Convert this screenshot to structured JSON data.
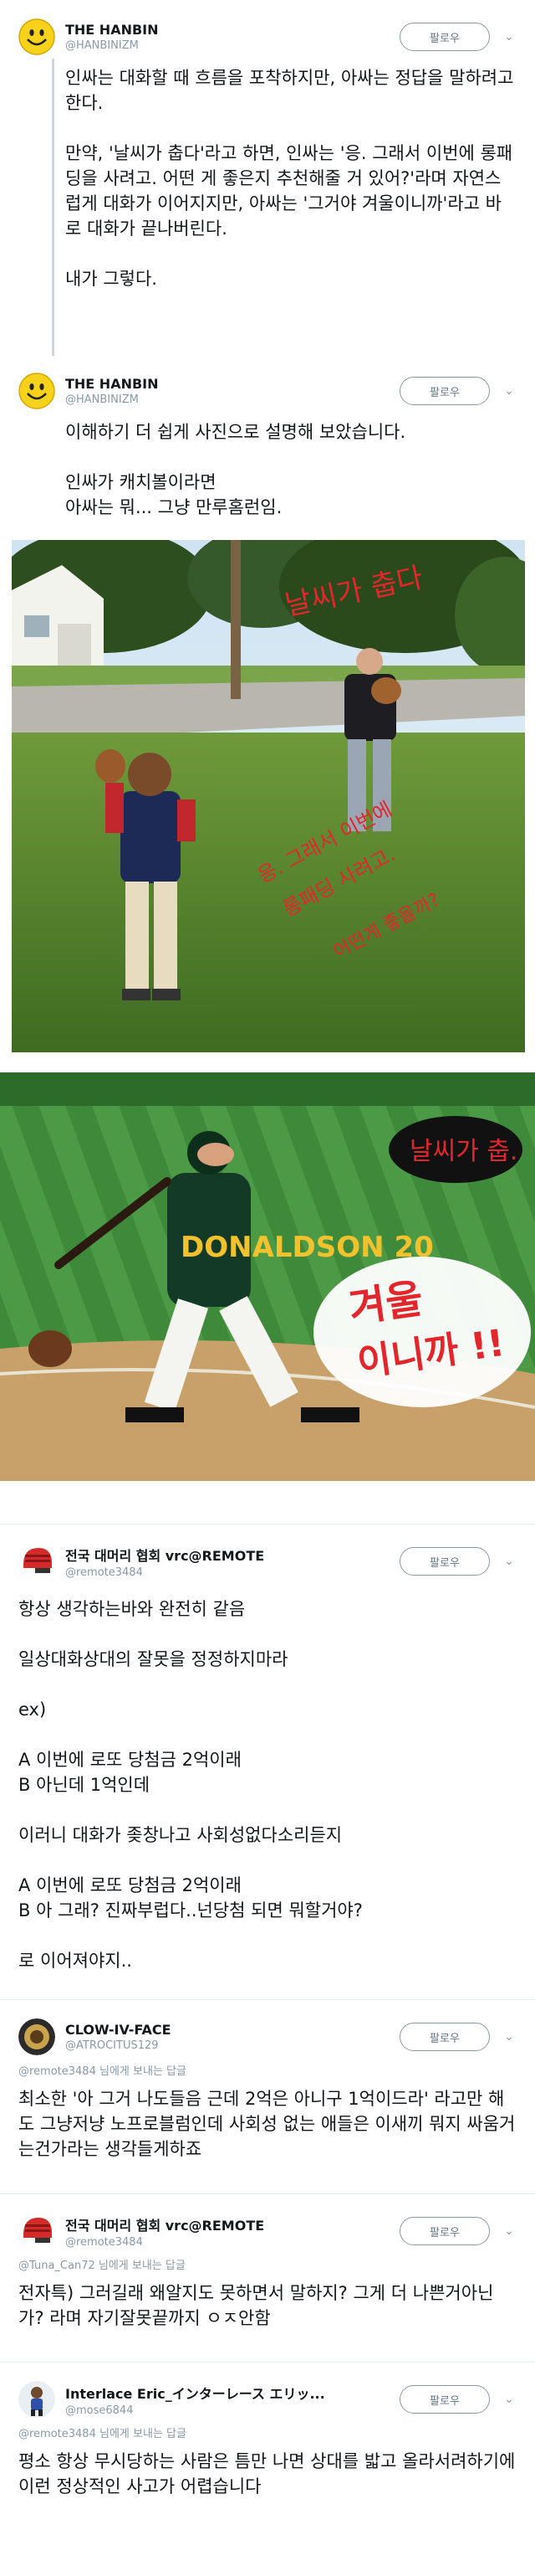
{
  "tweets": [
    {
      "name": "THE HANBIN",
      "handle": "@HANBINIZM",
      "follow_label": "팔로우",
      "paragraphs": [
        "인싸는 대화할 때 흐름을 포착하지만, 아싸는 정답을 말하려고 한다.",
        "만약, '날씨가 춥다'라고 하면, 인싸는 '응. 그래서 이번에 롱패딩을 사려고. 어떤 게 좋은지 추천해줄 거 있어?'라며 자연스럽게 대화가 이어지지만, 아싸는 '그거야 겨울이니까'라고 바로 대화가 끝나버린다.",
        "내가 그렇다."
      ]
    },
    {
      "name": "THE HANBIN",
      "handle": "@HANBINIZM",
      "follow_label": "팔로우",
      "paragraphs": [
        "이해하기 더 쉽게 사진으로 설명해 보았습니다.",
        "인싸가 캐치볼이라면\n아싸는 뭐... 그냥 만루홈런임."
      ],
      "photo1_texts": [
        "날씨가 춥다",
        "응. 그래서 이번에",
        "롱패딩 사려고.",
        "어떤게 좋을까?"
      ],
      "photo2_texts": [
        "날씨가 춥.",
        "겨울",
        "이니까 !!"
      ],
      "jersey_text": "DONALDSON 20"
    },
    {
      "name": "전국 대머리 협회 vrc@REMOTE",
      "handle": "@remote3484",
      "follow_label": "팔로우",
      "paragraphs": [
        "항상 생각하는바와 완전히 같음",
        "일상대화상대의 잘못을 정정하지마라",
        "ex)",
        "A 이번에 로또 당첨금 2억이래\nB 아닌데 1억인데",
        "이러니 대화가 좆창나고 사회성없다소리듣지",
        "A 이번에 로또 당첨금 2억이래\nB 아 그래? 진짜부럽다..넌당첨 되면 뭐할거야?",
        "로 이어져야지.."
      ]
    },
    {
      "name": "CLOW-IV-FACE",
      "handle": "@ATROCITUS129",
      "follow_label": "팔로우",
      "replyto": "@remote3484 님에게 보내는 답글",
      "paragraphs": [
        "최소한 '아 그거 나도들음 근데 2억은 아니구 1억이드라' 라고만 해도 그냥저냥 노프로블럼인데 사회성 없는 애들은 이새끼 뭐지 싸움거는건가라는 생각들게하죠"
      ]
    },
    {
      "name": "전국 대머리 협회 vrc@REMOTE",
      "handle": "@remote3484",
      "follow_label": "팔로우",
      "replyto": "@Tuna_Can72 님에게 보내는 답글",
      "paragraphs": [
        "전자특) 그러길래 왜알지도 못하면서 말하지? 그게 더 나쁜거아닌가? 라며 자기잘못끝까지 ㅇㅈ안함"
      ]
    },
    {
      "name": "Interlace Eric_インターレース エリッ...",
      "handle": "@mose6844",
      "follow_label": "팔로우",
      "replyto": "@remote3484 님에게 보내는 답글",
      "paragraphs": [
        "평소 항상 무시당하는 사람은 틈만 나면 상대를 밟고 올라서려하기에 이런 정상적인 사고가 어렵습니다"
      ]
    }
  ]
}
